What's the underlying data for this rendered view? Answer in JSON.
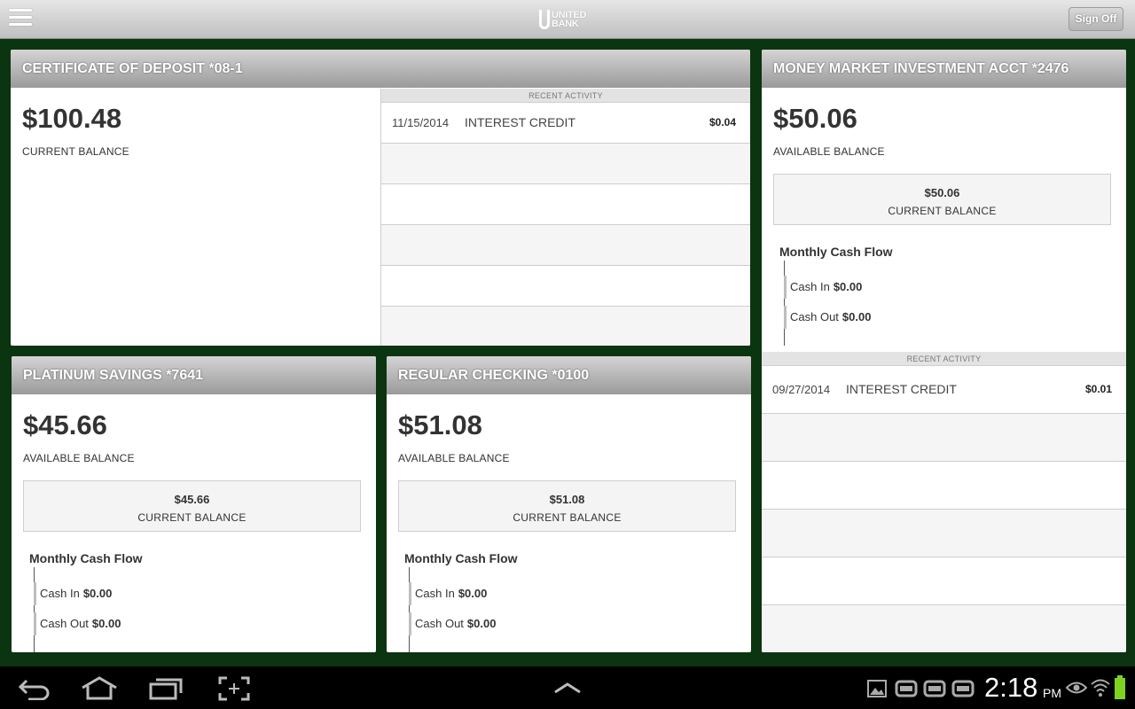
{
  "header": {
    "logo_line1": "UNITED",
    "logo_line2": "BANK",
    "signoff_label": "Sign Off"
  },
  "cd": {
    "title": "CERTIFICATE OF DEPOSIT *08-1",
    "balance": "$100.48",
    "balance_label": "CURRENT BALANCE",
    "activity_label": "RECENT ACTIVITY",
    "activity": [
      {
        "date": "11/15/2014",
        "desc": "INTEREST CREDIT",
        "amount": "$0.04"
      }
    ]
  },
  "money_market": {
    "title": "MONEY MARKET INVESTMENT ACCT *2476",
    "available": "$50.06",
    "available_label": "AVAILABLE BALANCE",
    "current": "$50.06",
    "current_label": "CURRENT BALANCE",
    "cash_flow_title": "Monthly Cash Flow",
    "cash_in_label": "Cash In",
    "cash_in": "$0.00",
    "cash_out_label": "Cash Out",
    "cash_out": "$0.00",
    "activity_label": "RECENT ACTIVITY",
    "activity": [
      {
        "date": "09/27/2014",
        "desc": "INTEREST CREDIT",
        "amount": "$0.01"
      }
    ]
  },
  "savings": {
    "title": "PLATINUM SAVINGS *7641",
    "available": "$45.66",
    "available_label": "AVAILABLE BALANCE",
    "current": "$45.66",
    "current_label": "CURRENT BALANCE",
    "cash_flow_title": "Monthly Cash Flow",
    "cash_in_label": "Cash In",
    "cash_in": "$0.00",
    "cash_out_label": "Cash Out",
    "cash_out": "$0.00"
  },
  "checking": {
    "title": "REGULAR CHECKING *0100",
    "available": "$51.08",
    "available_label": "AVAILABLE BALANCE",
    "current": "$51.08",
    "current_label": "CURRENT BALANCE",
    "cash_flow_title": "Monthly Cash Flow",
    "cash_in_label": "Cash In",
    "cash_in": "$0.00",
    "cash_out_label": "Cash Out",
    "cash_out": "$0.00"
  },
  "system": {
    "time": "2:18",
    "ampm": "PM"
  },
  "colors": {
    "background": "#0b3410",
    "header_gray": "#b5b5b5",
    "battery": "#7ed321"
  },
  "icons": [
    "menu-icon",
    "back-icon",
    "home-icon",
    "recent-apps-icon",
    "screenshot-icon",
    "up-arrow-icon",
    "gallery-icon",
    "usb-icon",
    "eye-icon",
    "wifi-icon",
    "battery-icon"
  ]
}
